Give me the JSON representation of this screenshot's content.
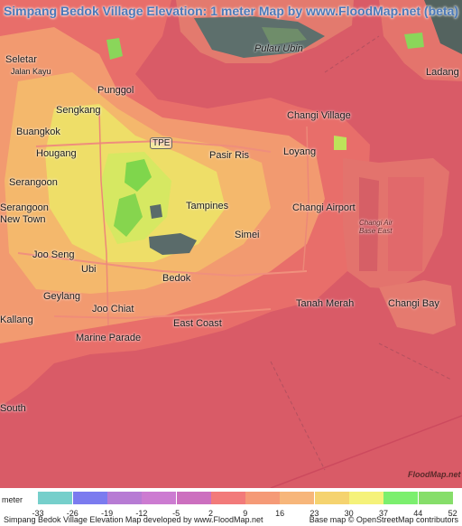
{
  "map": {
    "title": "Simpang Bedok Village Elevation: 1 meter Map by www.FloodMap.net (beta)",
    "places": [
      {
        "id": "seletar",
        "label": "Seletar"
      },
      {
        "id": "jalan-kayu",
        "label": "Jalan Kayu"
      },
      {
        "id": "punggol",
        "label": "Punggol"
      },
      {
        "id": "pulau-ubin",
        "label": "Pulau Ubin"
      },
      {
        "id": "ladang",
        "label": "Ladang"
      },
      {
        "id": "sengkang",
        "label": "Sengkang"
      },
      {
        "id": "buangkok",
        "label": "Buangkok"
      },
      {
        "id": "changi-village",
        "label": "Changi Village"
      },
      {
        "id": "hougang",
        "label": "Hougang"
      },
      {
        "id": "pasir-ris",
        "label": "Pasir Ris"
      },
      {
        "id": "loyang",
        "label": "Loyang"
      },
      {
        "id": "tpe",
        "label": "TPE"
      },
      {
        "id": "serangoon",
        "label": "Serangoon"
      },
      {
        "id": "tampines",
        "label": "Tampines"
      },
      {
        "id": "changi-airport",
        "label": "Changi Airport"
      },
      {
        "id": "serangoon-new-town",
        "label": "Serangoon New Town"
      },
      {
        "id": "simei",
        "label": "Simei"
      },
      {
        "id": "changi-air-base-east",
        "label": "Changi Air Base East"
      },
      {
        "id": "joo-seng",
        "label": "Joo Seng"
      },
      {
        "id": "ubi",
        "label": "Ubi"
      },
      {
        "id": "bedok",
        "label": "Bedok"
      },
      {
        "id": "geylang",
        "label": "Geylang"
      },
      {
        "id": "joo-chiat",
        "label": "Joo Chiat"
      },
      {
        "id": "tanah-merah",
        "label": "Tanah Merah"
      },
      {
        "id": "changi-bay",
        "label": "Changi Bay"
      },
      {
        "id": "east-coast",
        "label": "East Coast"
      },
      {
        "id": "marine-parade",
        "label": "Marine Parade"
      },
      {
        "id": "kallang",
        "label": "Kallang"
      },
      {
        "id": "south",
        "label": "South"
      }
    ]
  },
  "legend": {
    "unit_label": "meter",
    "ticks": [
      "-33",
      "-26",
      "-19",
      "-12",
      "-5",
      "2",
      "9",
      "16",
      "23",
      "30",
      "37",
      "44",
      "52"
    ],
    "swatch_colors": [
      "#ffffff",
      "#76cfcb",
      "#7b7bef",
      "#b77bd4",
      "#cc7bd1",
      "#cc6fbf",
      "#f27a7a",
      "#f59a77",
      "#f7b67a",
      "#f5d36f",
      "#f5f27a",
      "#7bef6e",
      "#86de6a"
    ],
    "credit_left": "Simpang Bedok Village Elevation Map developed by www.FloodMap.net",
    "credit_right": "Base map © OpenStreetMap contributors"
  },
  "logo_text": "FloodMap.net",
  "colors": {
    "sea": "#d95b67",
    "land_low": "#e86d6d",
    "land_mid": "#f4a070",
    "land_high": "#eee06a",
    "land_top": "#7fd64c",
    "water_dark": "#5a6b6a",
    "title": "#4a78b8"
  }
}
